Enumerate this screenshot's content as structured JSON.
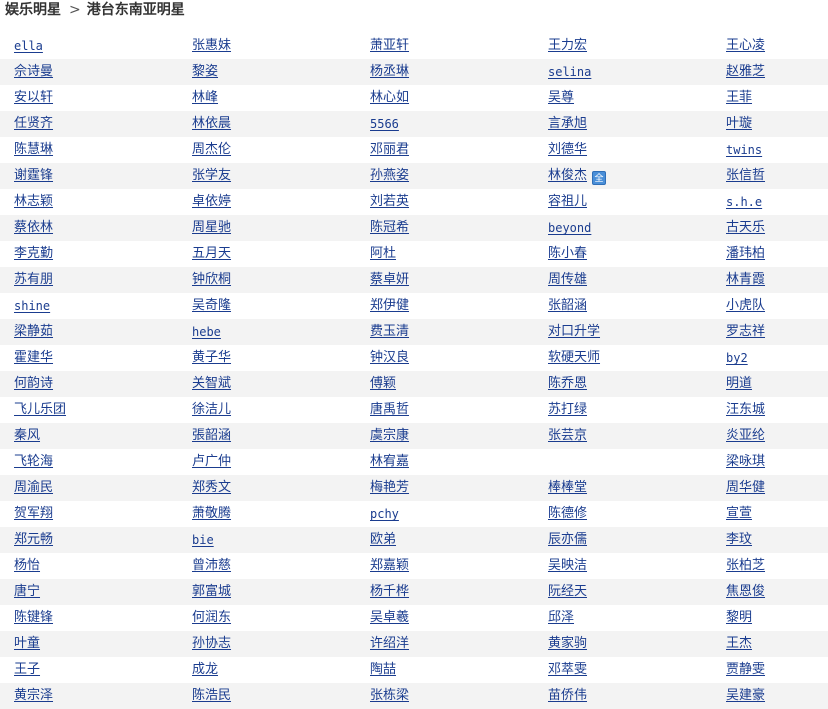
{
  "breadcrumb": {
    "parent": "娱乐明星",
    "separator": ">",
    "current": "港台东南亚明星"
  },
  "badge_text": "全",
  "rows": [
    [
      "ella",
      "张惠妹",
      "萧亚轩",
      "王力宏",
      "王心凌"
    ],
    [
      "佘诗曼",
      "黎姿",
      "杨丞琳",
      "selina",
      "赵雅芝"
    ],
    [
      "安以轩",
      "林峰",
      "林心如",
      "吴尊",
      "王菲"
    ],
    [
      "任贤齐",
      "林依晨",
      "5566",
      "言承旭",
      "叶璇"
    ],
    [
      "陈慧琳",
      "周杰伦",
      "邓丽君",
      "刘德华",
      "twins"
    ],
    [
      "谢霆锋",
      "张学友",
      "孙燕姿",
      "林俊杰",
      "张信哲"
    ],
    [
      "林志颖",
      "卓依婷",
      "刘若英",
      "容祖儿",
      "s.h.e"
    ],
    [
      "蔡依林",
      "周星驰",
      "陈冠希",
      "beyond",
      "古天乐"
    ],
    [
      "李克勤",
      "五月天",
      "阿杜",
      "陈小春",
      "潘玮柏"
    ],
    [
      "苏有朋",
      "钟欣桐",
      "蔡卓妍",
      "周传雄",
      "林青霞"
    ],
    [
      "shine",
      "吴奇隆",
      "郑伊健",
      "张韶涵",
      "小虎队"
    ],
    [
      "梁静茹",
      "hebe",
      "费玉清",
      "对口升学",
      "罗志祥"
    ],
    [
      "霍建华",
      "黄子华",
      "钟汉良",
      "软硬天师",
      "by2"
    ],
    [
      "何韵诗",
      "关智斌",
      "傅颖",
      "陈乔恩",
      "明道"
    ],
    [
      "飞儿乐团",
      "徐洁儿",
      "唐禹哲",
      "苏打绿",
      "汪东城"
    ],
    [
      "秦风",
      "張韶涵",
      "虞宗康",
      "张芸京",
      "炎亚纶"
    ],
    [
      "飞轮海",
      "卢广仲",
      "林宥嘉",
      "",
      "梁咏琪"
    ],
    [
      "周渝民",
      "郑秀文",
      "梅艳芳",
      "棒棒堂",
      "周华健"
    ],
    [
      "贺军翔",
      "萧敬腾",
      "pchy",
      "陈德修",
      "宣萱"
    ],
    [
      "郑元畅",
      "bie",
      "欧弟",
      "辰亦儒",
      "李玟"
    ],
    [
      "杨怡",
      "曾沛慈",
      "郑嘉颖",
      "吴映洁",
      "张柏芝"
    ],
    [
      "唐宁",
      "郭富城",
      "杨千桦",
      "阮经天",
      "焦恩俊"
    ],
    [
      "陈键锋",
      "何润东",
      "吴卓羲",
      "邱泽",
      "黎明"
    ],
    [
      "叶童",
      "孙协志",
      "许绍洋",
      "黄家驹",
      "王杰"
    ],
    [
      "王子",
      "成龙",
      "陶喆",
      "邓萃雯",
      "贾静雯"
    ],
    [
      "黄宗泽",
      "陈浩民",
      "张栋梁",
      "苗侨伟",
      "吴建豪"
    ]
  ]
}
